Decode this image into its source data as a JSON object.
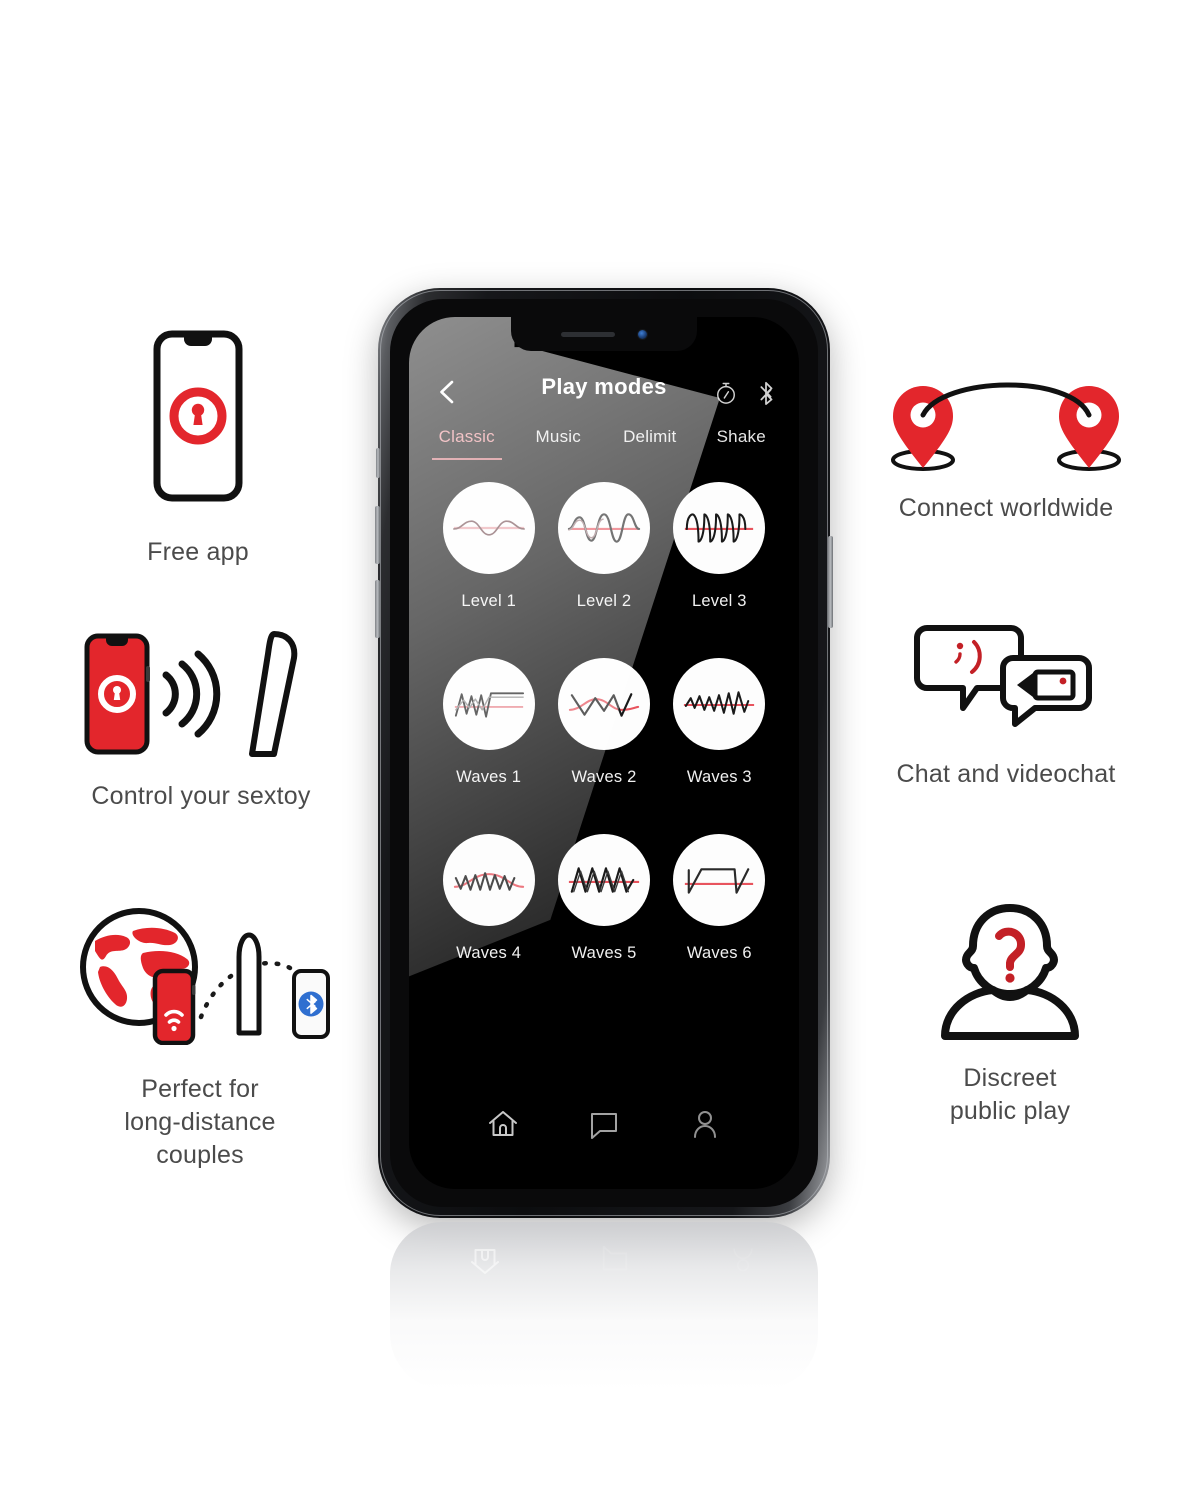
{
  "page": {
    "background": "#ffffff",
    "accent_red": "#E3262C",
    "text_gray": "#4b4b4b"
  },
  "features": {
    "left": [
      {
        "id": "free-app",
        "icon": "phone-with-lock-icon",
        "label": "Free app"
      },
      {
        "id": "control",
        "icon": "phone-signal-vibrator-icon",
        "label": "Control your sextoy"
      },
      {
        "id": "long-distance",
        "icon": "globe-phone-toy-bluetooth-icon",
        "label": "Perfect for\nlong-distance\ncouples"
      }
    ],
    "right": [
      {
        "id": "connect",
        "icon": "two-map-pins-arc-icon",
        "label": "Connect worldwide"
      },
      {
        "id": "chat",
        "icon": "speech-bubbles-videochat-icon",
        "label": "Chat and videochat"
      },
      {
        "id": "discreet",
        "icon": "person-question-mark-icon",
        "label": "Discreet\npublic play"
      }
    ]
  },
  "phone": {
    "notch": {
      "speaker": "speaker-grille",
      "camera": "front-camera"
    },
    "app": {
      "header": {
        "back_icon": "chevron-left-icon",
        "title": "Play modes",
        "actions": [
          {
            "name": "timer-icon",
            "label": "Timer"
          },
          {
            "name": "bluetooth-icon",
            "label": "Bluetooth"
          }
        ]
      },
      "tabs": [
        {
          "label": "Classic",
          "active": true
        },
        {
          "label": "Music",
          "active": false
        },
        {
          "label": "Delimit",
          "active": false
        },
        {
          "label": "Shake",
          "active": false
        }
      ],
      "modes": [
        {
          "label": "Level 1",
          "pattern": "sine-low-amplitude",
          "red_line": true
        },
        {
          "label": "Level 2",
          "pattern": "sine-medium-amplitude",
          "red_line": true
        },
        {
          "label": "Level 3",
          "pattern": "sine-high-frequency",
          "red_line": true
        },
        {
          "label": "Waves 1",
          "pattern": "zigzag-rising-plateau",
          "red_line": true
        },
        {
          "label": "Waves 2",
          "pattern": "wide-triangle-peaks",
          "red_line": true
        },
        {
          "label": "Waves 3",
          "pattern": "ramp-triangle-burst",
          "red_line": true
        },
        {
          "label": "Waves 4",
          "pattern": "dense-triangle-arc",
          "red_line": true
        },
        {
          "label": "Waves 5",
          "pattern": "sawtooth-peaks",
          "red_line": true
        },
        {
          "label": "Waves 6",
          "pattern": "square-plateau",
          "red_line": true
        }
      ],
      "navbar": [
        {
          "name": "home-icon",
          "label": "Home",
          "active": true
        },
        {
          "name": "chat-icon",
          "label": "Chat",
          "active": false
        },
        {
          "name": "user-icon",
          "label": "Profile",
          "active": false
        }
      ]
    }
  }
}
